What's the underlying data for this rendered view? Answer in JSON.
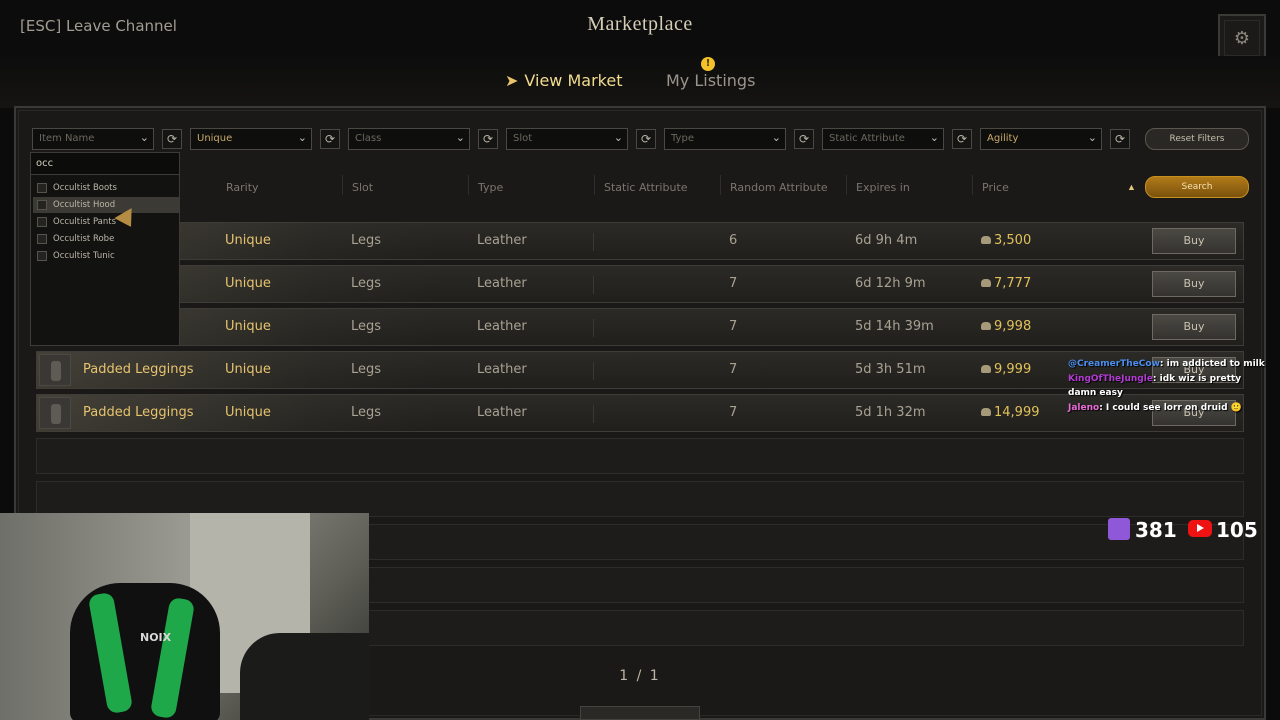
{
  "header": {
    "leave_label": "[ESC] Leave Channel",
    "title": "Marketplace"
  },
  "tabs": {
    "view_market": "View Market",
    "my_listings": "My Listings",
    "notification_badge": "!"
  },
  "filters": {
    "item_name": "Item Name",
    "rarity": "Unique",
    "class": "Class",
    "slot": "Slot",
    "type": "Type",
    "static_attribute": "Static Attribute",
    "random_attribute": "Agility",
    "reset_label": "Reset Filters",
    "search_label": "Search"
  },
  "dropdown": {
    "input_value": "occ",
    "items": [
      "Occultist Boots",
      "Occultist Hood",
      "Occultist Pants",
      "Occultist Robe",
      "Occultist Tunic"
    ]
  },
  "columns": [
    "Rarity",
    "Slot",
    "Type",
    "Static Attribute",
    "Random Attribute",
    "Expires in",
    "Price"
  ],
  "listings": [
    {
      "name": "",
      "rarity": "Unique",
      "slot": "Legs",
      "type": "Leather",
      "random_attr": "6",
      "expires": "6d 9h 4m",
      "price": "3,500",
      "buy": "Buy"
    },
    {
      "name": "",
      "rarity": "Unique",
      "slot": "Legs",
      "type": "Leather",
      "random_attr": "7",
      "expires": "6d 12h 9m",
      "price": "7,777",
      "buy": "Buy"
    },
    {
      "name": "",
      "rarity": "Unique",
      "slot": "Legs",
      "type": "Leather",
      "random_attr": "7",
      "expires": "5d 14h 39m",
      "price": "9,998",
      "buy": "Buy"
    },
    {
      "name": "Padded Leggings",
      "rarity": "Unique",
      "slot": "Legs",
      "type": "Leather",
      "random_attr": "7",
      "expires": "5d 3h 51m",
      "price": "9,999",
      "buy": "Buy"
    },
    {
      "name": "Padded Leggings",
      "rarity": "Unique",
      "slot": "Legs",
      "type": "Leather",
      "random_attr": "7",
      "expires": "5d 1h 32m",
      "price": "14,999",
      "buy": "Buy"
    }
  ],
  "pagination": "1 / 1",
  "stream": {
    "webcam_logo": "NOIX",
    "twitch_viewers": "381",
    "youtube_viewers": "105",
    "chat": [
      {
        "user": "@CreamerTheCow",
        "message": ": im addicted to milk"
      },
      {
        "user": "KingOfTheJungle",
        "message": ": idk wiz is pretty damn easy"
      },
      {
        "user": "Jaleno",
        "message": ": I could see lorr on druid 🙂"
      }
    ]
  },
  "colors": {
    "accent_gold": "#e7c36f",
    "price_gold": "#e2c15a",
    "search_orange": "#b07a18",
    "panel_bg": "#1a1917"
  },
  "icons": {
    "settings": "settings-icon",
    "refresh": "refresh-icon",
    "chevron": "chevron-down-icon",
    "coin": "coin-icon",
    "twitch": "twitch-icon",
    "youtube": "youtube-icon"
  }
}
